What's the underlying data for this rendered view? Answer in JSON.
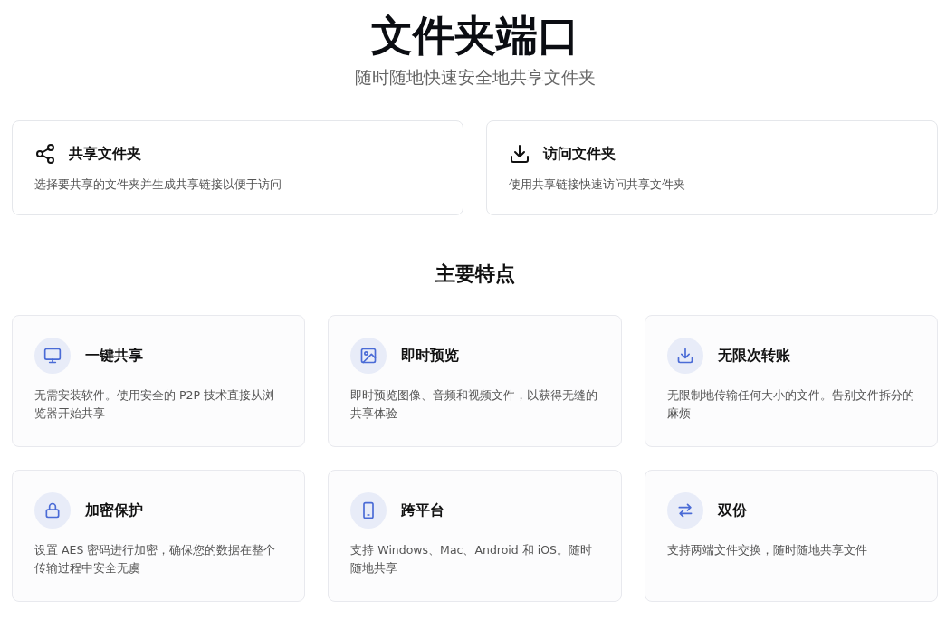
{
  "header": {
    "title": "文件夹端口",
    "subtitle": "随时随地快速安全地共享文件夹"
  },
  "actions": [
    {
      "title": "共享文件夹",
      "description": "选择要共享的文件夹并生成共享链接以便于访问"
    },
    {
      "title": "访问文件夹",
      "description": "使用共享链接快速访问共享文件夹"
    }
  ],
  "features_heading": "主要特点",
  "features": [
    {
      "title": "一键共享",
      "description": "无需安装软件。使用安全的 P2P 技术直接从浏览器开始共享"
    },
    {
      "title": "即时预览",
      "description": "即时预览图像、音频和视频文件，以获得无缝的共享体验"
    },
    {
      "title": "无限次转账",
      "description": "无限制地传输任何大小的文件。告别文件拆分的麻烦"
    },
    {
      "title": "加密保护",
      "description": "设置 AES 密码进行加密，确保您的数据在整个传输过程中安全无虞"
    },
    {
      "title": "跨平台",
      "description": "支持 Windows、Mac、Android 和 iOS。随时随地共享"
    },
    {
      "title": "双份",
      "description": "支持两端文件交换，随时随地共享文件"
    }
  ]
}
